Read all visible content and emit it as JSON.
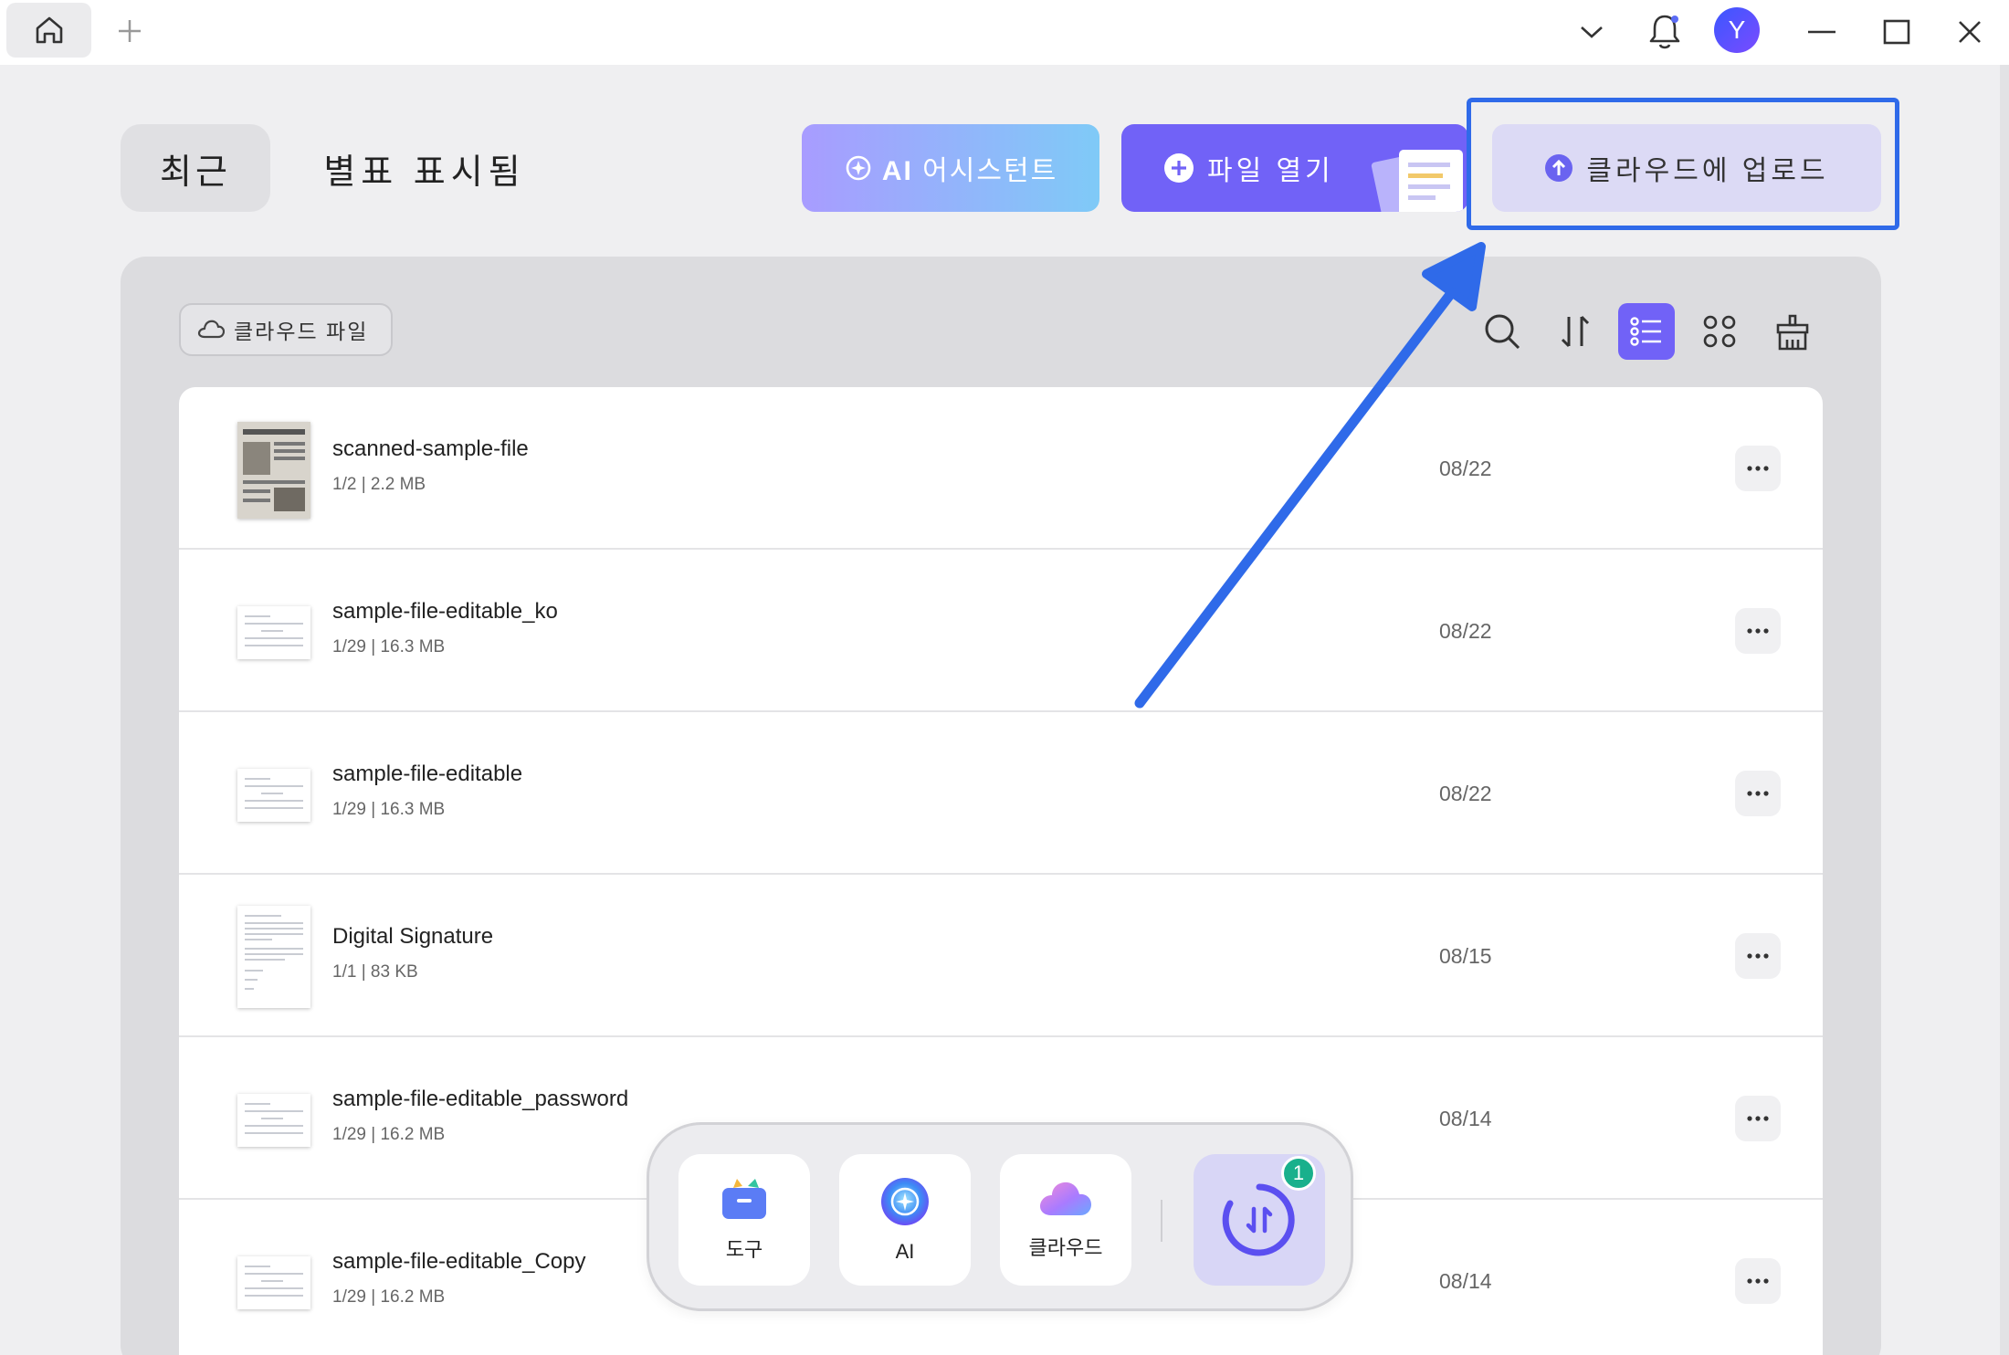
{
  "titlebar": {
    "avatar_letter": "Y"
  },
  "header": {
    "tab_recent": "최근",
    "tab_starred": "별표 표시됨",
    "ai_prefix": "AI",
    "ai_label": "어시스턴트",
    "open_file": "파일 열기",
    "upload_cloud": "클라우드에 업로드"
  },
  "toolbar": {
    "cloud_files": "클라우드 파일"
  },
  "files": [
    {
      "name": "scanned-sample-file",
      "meta": "1/2 | 2.2 MB",
      "date": "08/22"
    },
    {
      "name": "sample-file-editable_ko",
      "meta": "1/29 | 16.3 MB",
      "date": "08/22"
    },
    {
      "name": "sample-file-editable",
      "meta": "1/29 | 16.3 MB",
      "date": "08/22"
    },
    {
      "name": "Digital Signature",
      "meta": "1/1 | 83 KB",
      "date": "08/15"
    },
    {
      "name": "sample-file-editable_password",
      "meta": "1/29 | 16.2 MB",
      "date": "08/14"
    },
    {
      "name": "sample-file-editable_Copy",
      "meta": "1/29 | 16.2 MB",
      "date": "08/14"
    }
  ],
  "dock": {
    "tools": "도구",
    "ai": "AI",
    "cloud": "클라우드",
    "badge": "1"
  },
  "colors": {
    "accent": "#7162f7",
    "highlight": "#2f6ae9",
    "badge": "#19b08c"
  },
  "icons": [
    "home-icon",
    "plus-icon",
    "chevron-down-icon",
    "bell-icon",
    "minimize-icon",
    "maximize-icon",
    "close-icon",
    "search-icon",
    "sort-icon",
    "list-view-icon",
    "grid-view-icon",
    "clear-icon",
    "cloud-icon",
    "more-icon"
  ]
}
